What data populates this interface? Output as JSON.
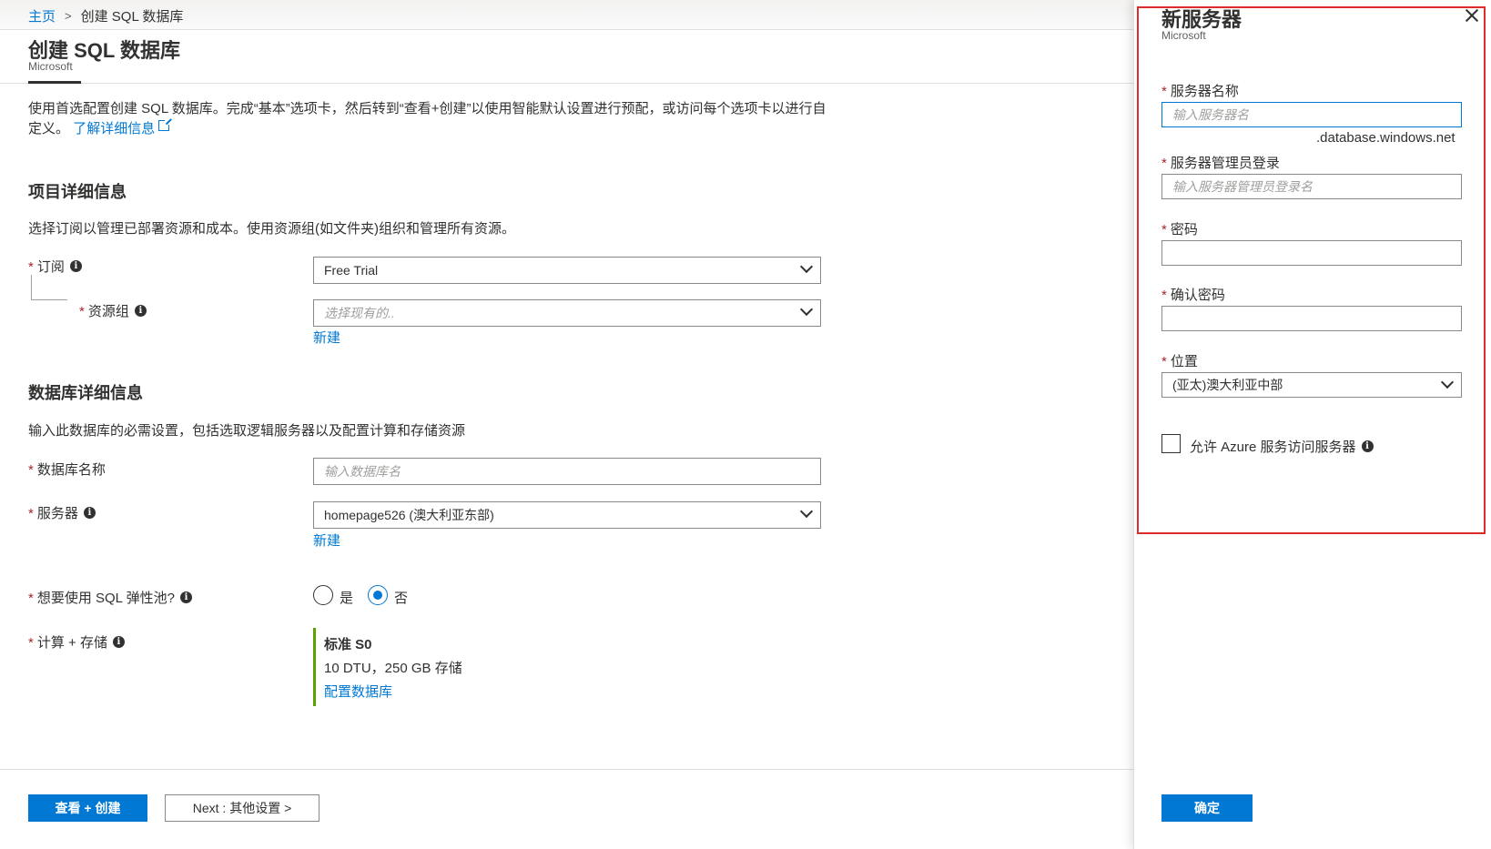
{
  "breadcrumb": {
    "home": "主页",
    "separator": ">",
    "current": "创建 SQL 数据库"
  },
  "page": {
    "title": "创建 SQL 数据库",
    "publisher": "Microsoft"
  },
  "intro": {
    "text": "使用首选配置创建 SQL 数据库。完成“基本”选项卡，然后转到“查看+创建”以使用智能默认设置进行预配，或访问每个选项卡以进行自定义。",
    "link": "了解详细信息"
  },
  "project": {
    "heading": "项目详细信息",
    "description": "选择订阅以管理已部署资源和成本。使用资源组(如文件夹)组织和管理所有资源。",
    "subscription_label": "订阅",
    "subscription_value": "Free Trial",
    "resource_group_label": "资源组",
    "resource_group_placeholder": "选择现有的..",
    "new_link": "新建"
  },
  "database": {
    "heading": "数据库详细信息",
    "description": "输入此数据库的必需设置，包括选取逻辑服务器以及配置计算和存储资源",
    "name_label": "数据库名称",
    "name_placeholder": "输入数据库名",
    "server_label": "服务器",
    "server_value": "homepage526 (澳大利亚东部)",
    "server_new_link": "新建",
    "elastic_label": "想要使用 SQL 弹性池?",
    "elastic_yes": "是",
    "elastic_no": "否",
    "compute_label": "计算 + 存储",
    "tier_title": "标准 S0",
    "tier_desc": "10 DTU，250 GB 存储",
    "tier_link": "配置数据库"
  },
  "footer": {
    "review_button": "查看 + 创建",
    "next_button": "Next : 其他设置 >"
  },
  "panel": {
    "title": "新服务器",
    "publisher": "Microsoft",
    "server_name_label": "服务器名称",
    "server_name_placeholder": "输入服务器名",
    "server_suffix": ".database.windows.net",
    "admin_label": "服务器管理员登录",
    "admin_placeholder": "输入服务器管理员登录名",
    "password_label": "密码",
    "confirm_label": "确认密码",
    "location_label": "位置",
    "location_value": "(亚太)澳大利亚中部",
    "allow_azure_label": "允许 Azure 服务访问服务器",
    "ok_button": "确定"
  },
  "colors": {
    "accent": "#0078d4",
    "highlight": "#e02b2b",
    "tier_bar": "#57a300",
    "required": "#a4262c"
  }
}
